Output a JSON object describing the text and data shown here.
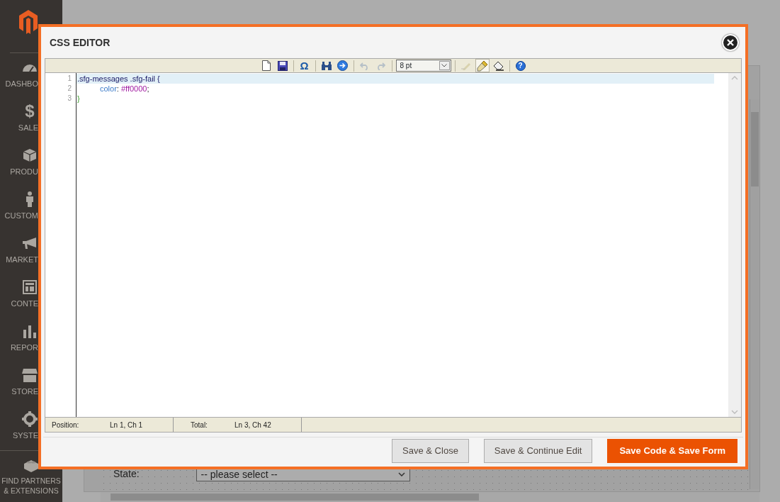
{
  "sidebar": {
    "items": [
      {
        "label": "DASHBO"
      },
      {
        "label": "SALE",
        "glyph": "$"
      },
      {
        "label": "PRODU"
      },
      {
        "label": "CUSTOM"
      },
      {
        "label": "MARKET"
      },
      {
        "label": "CONTE"
      },
      {
        "label": "REPOR"
      },
      {
        "label": "STORE"
      },
      {
        "label": "SYSTE"
      },
      {
        "label": "FIND PARTNERS & EXTENSIONS"
      }
    ]
  },
  "background_form": {
    "field_label": "State:",
    "select_value": "-- please select --"
  },
  "dialog": {
    "title": "CSS EDITOR",
    "toolbar": [
      {
        "kind": "button",
        "disabled": false,
        "selected": false
      },
      {
        "kind": "button",
        "disabled": false,
        "selected": false
      },
      {
        "kind": "separator"
      },
      {
        "kind": "button",
        "text": "Ω",
        "disabled": false,
        "selected": false
      },
      {
        "kind": "separator"
      },
      {
        "kind": "button",
        "disabled": false,
        "selected": false
      },
      {
        "kind": "button",
        "disabled": false,
        "selected": false
      },
      {
        "kind": "separator"
      },
      {
        "kind": "button",
        "disabled": true,
        "selected": false
      },
      {
        "kind": "button",
        "disabled": true,
        "selected": false
      },
      {
        "kind": "separator"
      },
      {
        "kind": "select",
        "value": "8 pt"
      },
      {
        "kind": "separator"
      },
      {
        "kind": "button",
        "disabled": true,
        "selected": false
      },
      {
        "kind": "button",
        "disabled": false,
        "selected": true
      },
      {
        "kind": "button",
        "disabled": false,
        "selected": false
      },
      {
        "kind": "separator"
      },
      {
        "kind": "button",
        "text": "?",
        "disabled": false,
        "selected": false
      }
    ],
    "code_lines": [
      {
        "number": "1",
        "selected": true,
        "indent": false,
        "tokens": [
          {
            "kind": "selector",
            "text": ".sfg-messages .sfg-fail {"
          }
        ]
      },
      {
        "number": "2",
        "selected": false,
        "indent": true,
        "tokens": [
          {
            "kind": "property",
            "text": "color"
          },
          {
            "kind": "punct",
            "text": ": "
          },
          {
            "kind": "value",
            "text": "#ff0000"
          },
          {
            "kind": "punct",
            "text": ";"
          }
        ]
      },
      {
        "number": "3",
        "selected": false,
        "indent": false,
        "tokens": [
          {
            "kind": "brace",
            "text": "}"
          }
        ]
      }
    ],
    "status_bar": [
      {
        "label": "Position:",
        "value": "Ln 1, Ch 1"
      },
      {
        "label": "Total:",
        "value": "Ln 3, Ch 42"
      }
    ],
    "buttons": [
      {
        "label": "Save & Close",
        "kind": "secondary"
      },
      {
        "label": "Save & Continue Edit",
        "kind": "secondary"
      },
      {
        "label": "Save Code & Save Form",
        "kind": "primary"
      }
    ]
  }
}
